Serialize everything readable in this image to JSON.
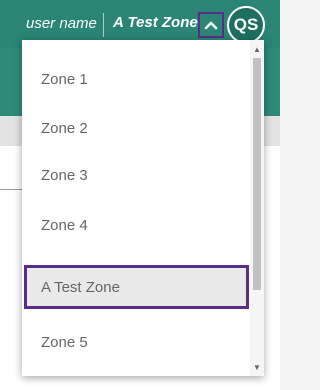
{
  "header": {
    "user_name": "user name",
    "zone_name": "A Test Zone",
    "avatar_initials": "QS",
    "toggle_icon": "chevron-up-icon"
  },
  "dropdown": {
    "items": [
      {
        "label": "Zone 1"
      },
      {
        "label": "Zone 2"
      },
      {
        "label": "Zone 3"
      },
      {
        "label": "Zone 4"
      },
      {
        "label": "A Test Zone",
        "selected": true
      },
      {
        "label": "Zone 5"
      }
    ],
    "scroll_up_glyph": "▲",
    "scroll_down_glyph": "▼"
  },
  "colors": {
    "header_bg": "#2a8574",
    "highlight_border": "#5b2d8a",
    "item_text": "#666666"
  }
}
